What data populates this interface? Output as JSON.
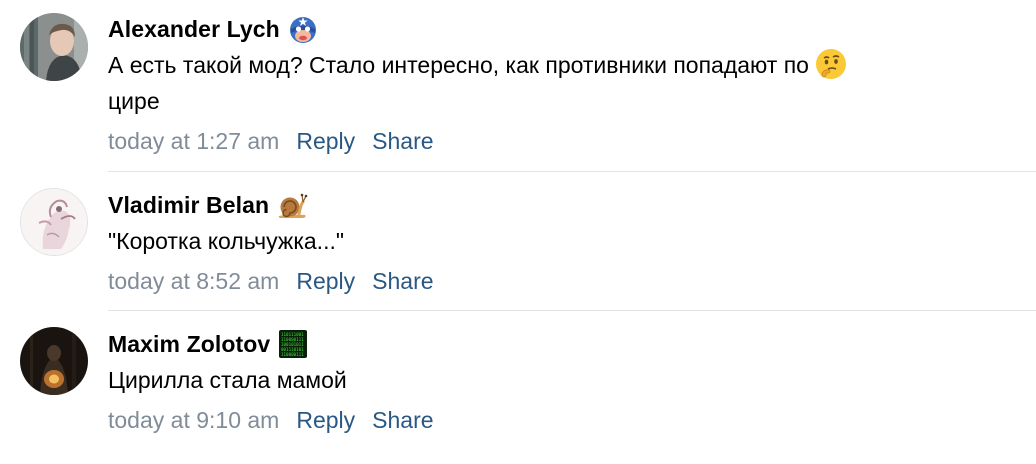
{
  "comments": [
    {
      "author": "Alexander Lych",
      "badge_icon": "superhero-mask-icon",
      "text": "А есть такой мод? Стало интересно, как противники попадают по",
      "text_emoji": "thinking-face-icon",
      "text_tail": "цире",
      "time": "today at 1:27 am",
      "reply_label": "Reply",
      "share_label": "Share"
    },
    {
      "author": "Vladimir Belan",
      "badge_icon": "snail-icon",
      "text": "\"Коротка кольчужка...\"",
      "time": "today at 8:52 am",
      "reply_label": "Reply",
      "share_label": "Share"
    },
    {
      "author": "Maxim Zolotov",
      "badge_icon": "binary-code-icon",
      "text": "Цирилла стала мамой",
      "time": "today at 9:10 am",
      "reply_label": "Reply",
      "share_label": "Share"
    }
  ],
  "colors": {
    "link": "#2a5885",
    "meta": "#818c99",
    "divider": "#e1e3e6"
  }
}
